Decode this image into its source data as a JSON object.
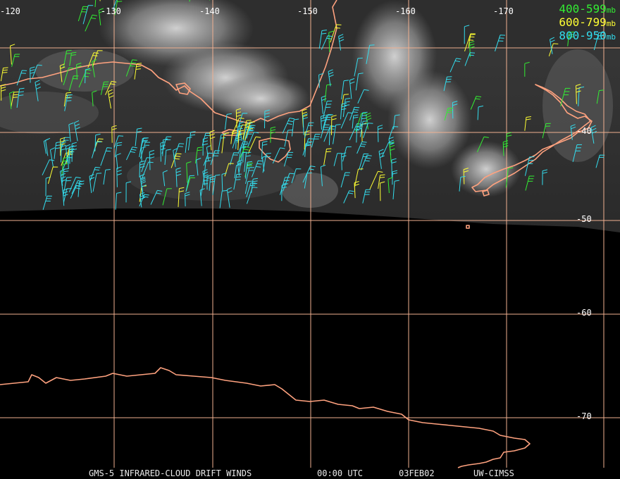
{
  "lon_labels": [
    "-120",
    "-130",
    "-140",
    "-150",
    "-160",
    "-170"
  ],
  "lat_labels": [
    "-40",
    "-50",
    "-60",
    "-70"
  ],
  "legend": [
    {
      "label": "400-599",
      "unit": "mb",
      "color": "#33ee33"
    },
    {
      "label": "600-799",
      "unit": "mb",
      "color": "#ffff33"
    },
    {
      "label": "800-950",
      "unit": "mb",
      "color": "#33ddee"
    }
  ],
  "footer": {
    "product": "GMS-5 INFRARED-CLOUD DRIFT WINDS",
    "time": "00:00 UTC",
    "date": "03FEB02",
    "source": "UW-CIMSS"
  },
  "colors": {
    "grid": "#f0b090",
    "coast": "#ffa27f",
    "background": "#000000"
  }
}
